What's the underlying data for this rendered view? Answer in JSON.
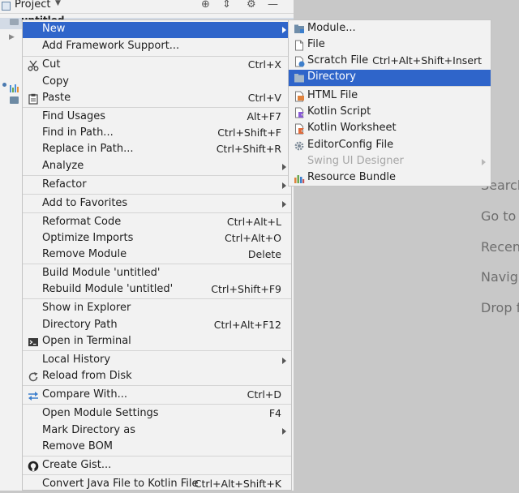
{
  "project_panel": {
    "title": "Project",
    "tree_label": "untitled"
  },
  "hints": [
    "Search",
    "Go to",
    "Recent",
    "Navig",
    "Drop f"
  ],
  "context_menu": {
    "items": [
      {
        "label": "New",
        "shortcut": "",
        "submenu": true
      },
      {
        "label": "Add Framework Support...",
        "shortcut": ""
      },
      {
        "label": "Cut",
        "shortcut": "Ctrl+X",
        "icon": "scissors-icon"
      },
      {
        "label": "Copy",
        "shortcut": ""
      },
      {
        "label": "Paste",
        "shortcut": "Ctrl+V",
        "icon": "clipboard-icon"
      },
      {
        "label": "Find Usages",
        "shortcut": "Alt+F7"
      },
      {
        "label": "Find in Path...",
        "shortcut": "Ctrl+Shift+F"
      },
      {
        "label": "Replace in Path...",
        "shortcut": "Ctrl+Shift+R"
      },
      {
        "label": "Analyze",
        "shortcut": "",
        "submenu": true
      },
      {
        "label": "Refactor",
        "shortcut": "",
        "submenu": true
      },
      {
        "label": "Add to Favorites",
        "shortcut": "",
        "submenu": true
      },
      {
        "label": "Reformat Code",
        "shortcut": "Ctrl+Alt+L"
      },
      {
        "label": "Optimize Imports",
        "shortcut": "Ctrl+Alt+O"
      },
      {
        "label": "Remove Module",
        "shortcut": "Delete"
      },
      {
        "label": "Build Module 'untitled'",
        "shortcut": ""
      },
      {
        "label": "Rebuild Module 'untitled'",
        "shortcut": "Ctrl+Shift+F9"
      },
      {
        "label": "Show in Explorer",
        "shortcut": ""
      },
      {
        "label": "Directory Path",
        "shortcut": "Ctrl+Alt+F12"
      },
      {
        "label": "Open in Terminal",
        "shortcut": "",
        "icon": "terminal-icon"
      },
      {
        "label": "Local History",
        "shortcut": "",
        "submenu": true
      },
      {
        "label": "Reload from Disk",
        "shortcut": "",
        "icon": "reload-icon"
      },
      {
        "label": "Compare With...",
        "shortcut": "Ctrl+D",
        "icon": "compare-icon"
      },
      {
        "label": "Open Module Settings",
        "shortcut": "F4"
      },
      {
        "label": "Mark Directory as",
        "shortcut": "",
        "submenu": true
      },
      {
        "label": "Remove BOM",
        "shortcut": ""
      },
      {
        "label": "Create Gist...",
        "shortcut": "",
        "icon": "github-icon"
      },
      {
        "label": "Convert Java File to Kotlin File",
        "shortcut": "Ctrl+Alt+Shift+K"
      }
    ]
  },
  "submenu_new": {
    "items": [
      {
        "label": "Module...",
        "shortcut": "",
        "icon": "module-icon"
      },
      {
        "label": "File",
        "shortcut": "",
        "icon": "file-icon"
      },
      {
        "label": "Scratch File",
        "shortcut": "Ctrl+Alt+Shift+Insert",
        "icon": "scratch-file-icon"
      },
      {
        "label": "Directory",
        "shortcut": "",
        "icon": "folder-icon"
      },
      {
        "label": "HTML File",
        "shortcut": "",
        "icon": "html-file-icon"
      },
      {
        "label": "Kotlin Script",
        "shortcut": "",
        "icon": "kotlin-script-icon"
      },
      {
        "label": "Kotlin Worksheet",
        "shortcut": "",
        "icon": "kotlin-worksheet-icon"
      },
      {
        "label": "EditorConfig File",
        "shortcut": "",
        "icon": "gear-icon"
      },
      {
        "label": "Swing UI Designer",
        "shortcut": "",
        "submenu": true
      },
      {
        "label": "Resource Bundle",
        "shortcut": "",
        "icon": "resource-bundle-icon"
      }
    ]
  },
  "colors": {
    "selection": "#2f65ca",
    "menu_bg": "#f2f2f2",
    "workspace_bg": "#c8c8c8"
  }
}
